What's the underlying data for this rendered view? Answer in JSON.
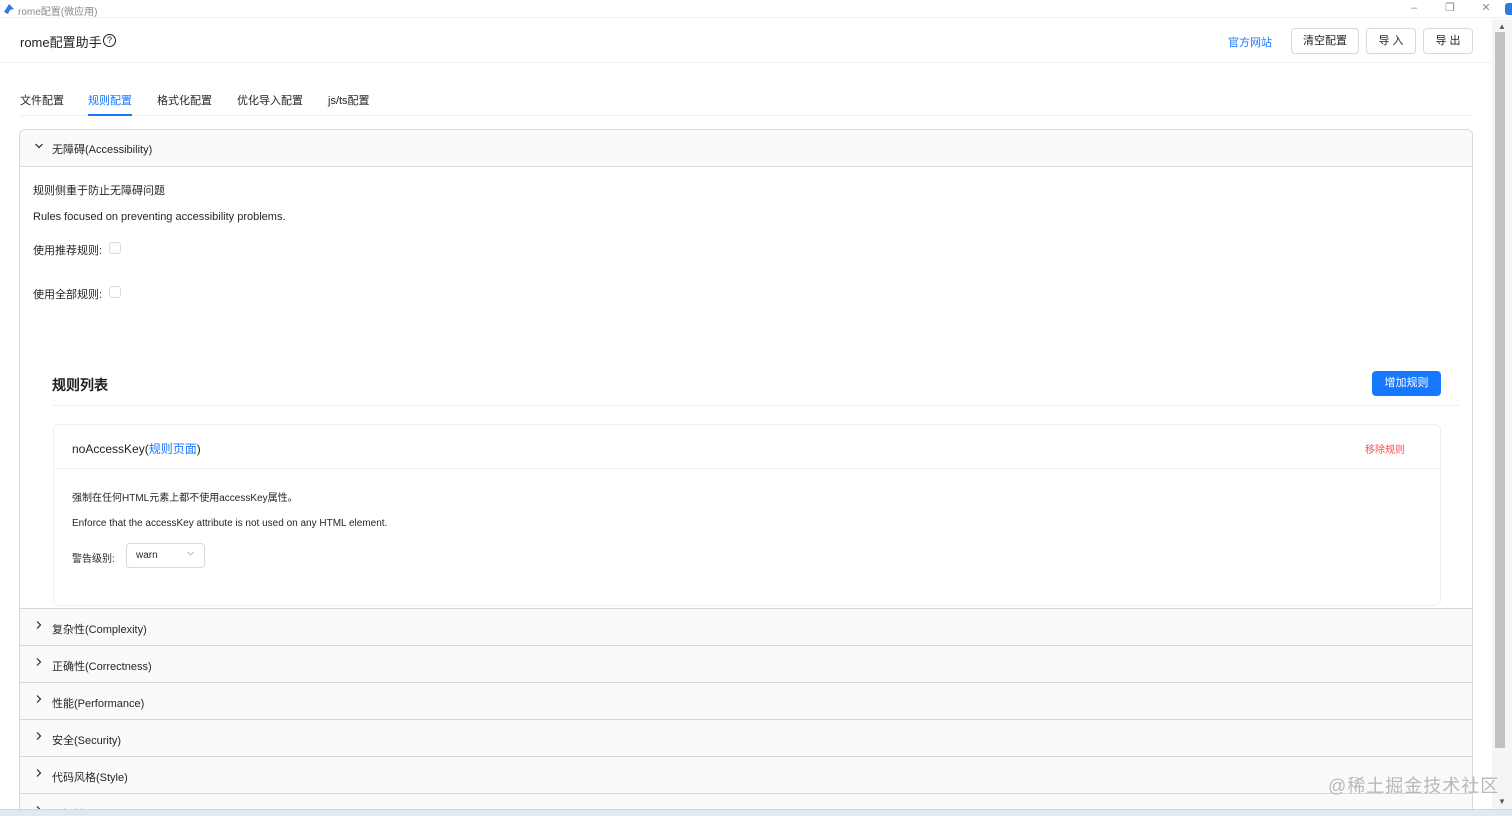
{
  "window": {
    "title": "rome配置(微应用)",
    "controls": {
      "minimize": "–",
      "restore": "❐",
      "close": "✕"
    }
  },
  "header": {
    "title": "rome配置助手",
    "help_icon": "?",
    "official_site": "官方网站",
    "clear_button": "清空配置",
    "import_button": "导 入",
    "export_button": "导 出"
  },
  "tabs": [
    {
      "label": "文件配置",
      "active": false
    },
    {
      "label": "规则配置",
      "active": true
    },
    {
      "label": "格式化配置",
      "active": false
    },
    {
      "label": "优化导入配置",
      "active": false
    },
    {
      "label": "js/ts配置",
      "active": false
    }
  ],
  "accessibility_panel": {
    "title": "无障碍(Accessibility)",
    "expanded": true,
    "desc_zh": "规则侧重于防止无障碍问题",
    "desc_en": "Rules focused on preventing accessibility problems.",
    "use_recommended_label": "使用推荐规则:",
    "use_recommended_checked": false,
    "use_all_label": "使用全部规则:",
    "use_all_checked": false,
    "rules_list_title": "规则列表",
    "add_rule_button": "增加规则",
    "rules": [
      {
        "name": "noAccessKey(",
        "link_text": "规则页面",
        "name_suffix": ")",
        "remove": "移除规则",
        "desc_zh": "强制在任何HTML元素上都不使用accessKey属性。",
        "desc_en": "Enforce that the accessKey attribute is not used on any HTML element.",
        "level_label": "警告级别:",
        "level_value": "warn"
      }
    ]
  },
  "collapsed_panels": [
    {
      "title": "复杂性(Complexity)"
    },
    {
      "title": "正确性(Correctness)"
    },
    {
      "title": "性能(Performance)"
    },
    {
      "title": "安全(Security)"
    },
    {
      "title": "代码风格(Style)"
    },
    {
      "title": "可疑性(Suspicious)"
    }
  ],
  "watermark": "@稀土掘金技术社区",
  "colors": {
    "primary": "#1677ff",
    "danger": "#ff4d4f",
    "border": "#d9d9d9",
    "panel_bg": "#fafafa"
  }
}
